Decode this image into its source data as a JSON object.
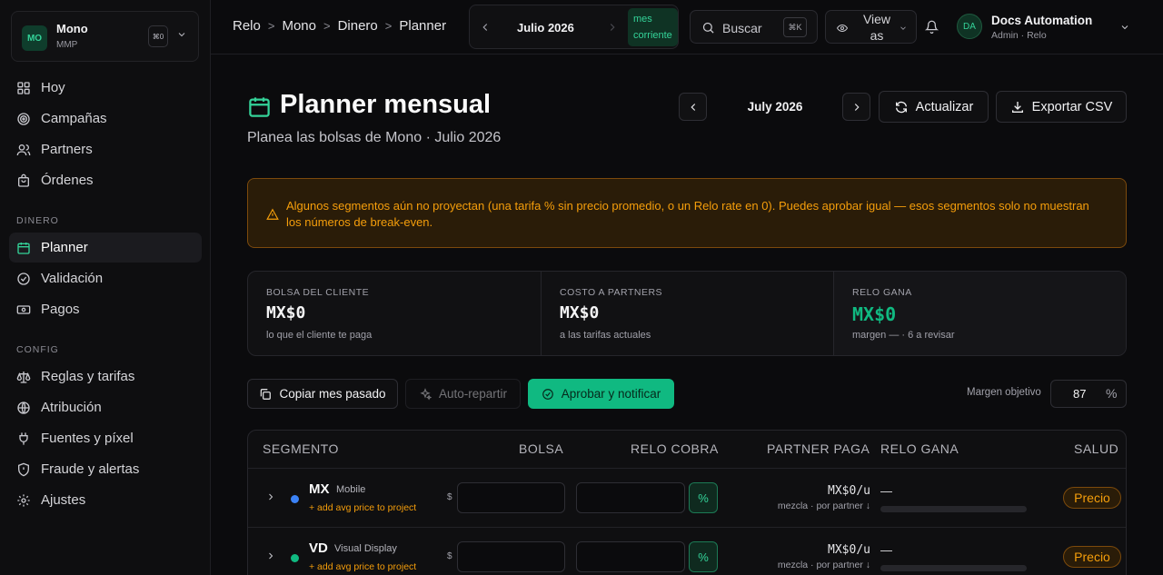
{
  "workspace": {
    "initials": "MO",
    "name": "Mono",
    "sub": "MMP",
    "kbd": "⌘0"
  },
  "nav": {
    "main": [
      "Hoy",
      "Campañas",
      "Partners",
      "Órdenes"
    ],
    "dinero_label": "DINERO",
    "dinero": [
      "Planner",
      "Validación",
      "Pagos"
    ],
    "config_label": "CONFIG",
    "config": [
      "Reglas y tarifas",
      "Atribución",
      "Fuentes y píxel",
      "Fraude y alertas",
      "Ajustes"
    ]
  },
  "breadcrumb": [
    "Relo",
    "Mono",
    "Dinero",
    "Planner"
  ],
  "month_nav": {
    "label": "Julio 2026",
    "current_line1": "mes",
    "current_line2": "corriente"
  },
  "search": {
    "label": "Buscar",
    "kbd": "⌘K"
  },
  "view_as": {
    "line1": "View",
    "line2": "as"
  },
  "user": {
    "initials": "DA",
    "name": "Docs Automation",
    "role": "Admin · Relo"
  },
  "page": {
    "title": "Planner mensual",
    "subtitle": "Planea las bolsas de Mono · Julio 2026",
    "period": "July 2026",
    "refresh_label": "Actualizar",
    "export_label": "Exportar CSV"
  },
  "warning": "Algunos segmentos aún no proyectan (una tarifa % sin precio promedio, o un Relo rate en 0). Puedes aprobar igual — esos segmentos solo no muestran los números de break-even.",
  "stats": [
    {
      "label": "BOLSA DEL CLIENTE",
      "value": "MX$0",
      "hint": "lo que el cliente te paga"
    },
    {
      "label": "COSTO A PARTNERS",
      "value": "MX$0",
      "hint": "a las tarifas actuales"
    },
    {
      "label": "RELO GANA",
      "value": "MX$0",
      "hint": "margen — · 6 a revisar"
    }
  ],
  "actions": {
    "copy": "Copiar mes pasado",
    "auto": "Auto-repartir",
    "approve": "Aprobar y notificar",
    "margin_label": "Margen objetivo",
    "margin_value": "87",
    "margin_unit": "%"
  },
  "table": {
    "headers": [
      "SEGMENTO",
      "BOLSA",
      "RELO COBRA",
      "PARTNER PAGA",
      "RELO GANA",
      "SALUD"
    ],
    "rows": [
      {
        "code": "MX",
        "name": "Mobile",
        "add": "+ add avg price to project",
        "currency": "$",
        "pct": "%",
        "partner_paga": "MX$0/u",
        "partner_sub": "mezcla · por partner ↓",
        "relo_gana": "—",
        "salud": "Precio",
        "dot_color": "#3b82f6"
      },
      {
        "code": "VD",
        "name": "Visual Display",
        "add": "+ add avg price to project",
        "currency": "$",
        "pct": "%",
        "partner_paga": "MX$0/u",
        "partner_sub": "mezcla · por partner ↓",
        "relo_gana": "—",
        "salud": "Precio",
        "dot_color": "#10b981"
      }
    ]
  },
  "colors": {
    "accent": "#10b981",
    "warning": "#f59e0b",
    "background": "#0b0b0d"
  }
}
